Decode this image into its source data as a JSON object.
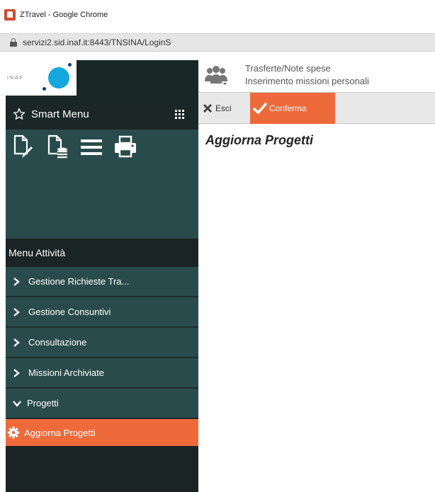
{
  "window": {
    "title": "ZTravel - Google Chrome",
    "url": "servizi2.sid.inaf.it:8443/TNSINA/LoginS"
  },
  "brand": {
    "logo_text": "INAF",
    "logo_color": "#13a7dd"
  },
  "smart_menu": {
    "label": "Smart Menu",
    "tools": [
      {
        "name": "new-document-edit-icon"
      },
      {
        "name": "new-document-database-icon"
      },
      {
        "name": "list-icon"
      },
      {
        "name": "print-icon"
      }
    ]
  },
  "menu": {
    "header": "Menu Attività",
    "items": [
      {
        "label": "Gestione Richieste Tra...",
        "icon": "chevron-right-icon"
      },
      {
        "label": "Gestione Consuntivi",
        "icon": "chevron-right-icon"
      },
      {
        "label": "Consultazione",
        "icon": "chevron-right-icon"
      },
      {
        "label": "Missioni Archiviate",
        "icon": "chevron-right-icon"
      },
      {
        "label": "Progetti",
        "icon": "chevron-down-icon"
      },
      {
        "label": "Aggiorna Progetti",
        "icon": "gear-icon",
        "active": true
      }
    ]
  },
  "header": {
    "line1": "Trasferte/Note spese",
    "line2": "Inserimento missioni personali"
  },
  "toolbar": {
    "esci_label": "Esci",
    "conferma_label": "Conferma"
  },
  "main": {
    "title": "Aggiorna Progetti"
  },
  "colors": {
    "accent": "#ef6a3a",
    "sidebar_dark": "#1b2424",
    "sidebar_teal": "#2a4b4b"
  }
}
